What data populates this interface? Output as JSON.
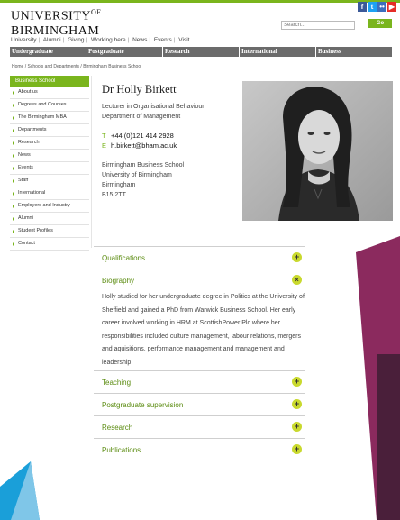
{
  "header": {
    "logo_line1": "UNIVERSITY",
    "logo_of": "OF",
    "logo_line2": "BIRMINGHAM",
    "social": [
      "f",
      "t",
      "••",
      "▶"
    ],
    "social_icons": [
      "facebook-icon",
      "twitter-icon",
      "flickr-icon",
      "youtube-icon"
    ],
    "social_colors": [
      "#3b5998",
      "#1da1f2",
      "#3c6ebd",
      "#e52d27"
    ],
    "search_placeholder": "Search...",
    "go_label": "Go",
    "utility_nav": [
      "University",
      "Alumni",
      "Giving",
      "Working here",
      "News",
      "Events",
      "Visit"
    ],
    "main_nav": [
      "Undergraduate",
      "Postgraduate",
      "Research",
      "International",
      "Business"
    ]
  },
  "breadcrumb": "Home / Schools and Departments / Birmingham Business School",
  "sidebar": {
    "heading": "Business School",
    "items": [
      "About us",
      "Degrees and Courses",
      "The Birmingham MBA",
      "Departments",
      "Research",
      "News",
      "Events",
      "Staff",
      "International",
      "Employers and Industry",
      "Alumni",
      "Student Profiles",
      "Contact"
    ]
  },
  "profile": {
    "name": "Dr Holly Birkett",
    "title_line1": "Lecturer in Organisational Behaviour",
    "title_line2": "Department of Management",
    "tel_label": "T",
    "tel": "+44 (0)121 414 2928",
    "email_label": "E",
    "email": "h.birkett@bham.ac.uk",
    "address": [
      "Birmingham Business School",
      "University of Birmingham",
      "Birmingham",
      "B15 2TT"
    ]
  },
  "accordion": {
    "qualifications": "Qualifications",
    "biography": "Biography",
    "biography_text": "Holly studied for her undergraduate degree in Politics at the University of Sheffield and gained a PhD from Warwick Business School. Her early career involved working in HRM at ScottishPower Plc where her responsibilities included culture management, labour relations, mergers and aquisitions, performance management and management and leadership",
    "teaching": "Teaching",
    "postgraduate_supervision": "Postgraduate supervision",
    "research": "Research",
    "publications": "Publications",
    "expand_symbol": "+",
    "collapse_symbol": "×"
  },
  "colors": {
    "brand_green": "#7ab51d",
    "accordion_button": "#c9d92e",
    "nav_grey": "#6b6b6b",
    "deco_purple": "#8b2a5e",
    "deco_blue": "#1a9fd9"
  }
}
